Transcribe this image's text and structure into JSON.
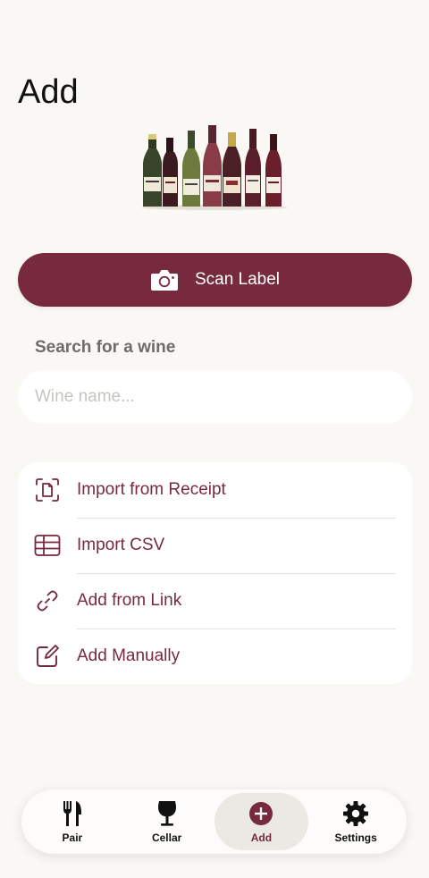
{
  "header": {
    "title": "Add"
  },
  "hero": {
    "image": "wine-bottles-illustration"
  },
  "scan": {
    "label": "Scan Label",
    "icon": "camera-icon"
  },
  "search": {
    "section_label": "Search for a wine",
    "placeholder": "Wine name...",
    "value": ""
  },
  "actions": [
    {
      "label": "Import from Receipt",
      "icon": "receipt-scan-icon"
    },
    {
      "label": "Import CSV",
      "icon": "table-icon"
    },
    {
      "label": "Add from Link",
      "icon": "link-icon"
    },
    {
      "label": "Add Manually",
      "icon": "edit-icon"
    }
  ],
  "tabs": [
    {
      "label": "Pair",
      "icon": "fork-knife-icon",
      "active": false
    },
    {
      "label": "Cellar",
      "icon": "wine-glass-icon",
      "active": false
    },
    {
      "label": "Add",
      "icon": "plus-circle-icon",
      "active": true
    },
    {
      "label": "Settings",
      "icon": "gear-icon",
      "active": false
    }
  ],
  "colors": {
    "accent": "#772a3d",
    "background": "#faf8f4",
    "card": "#ffffff"
  }
}
